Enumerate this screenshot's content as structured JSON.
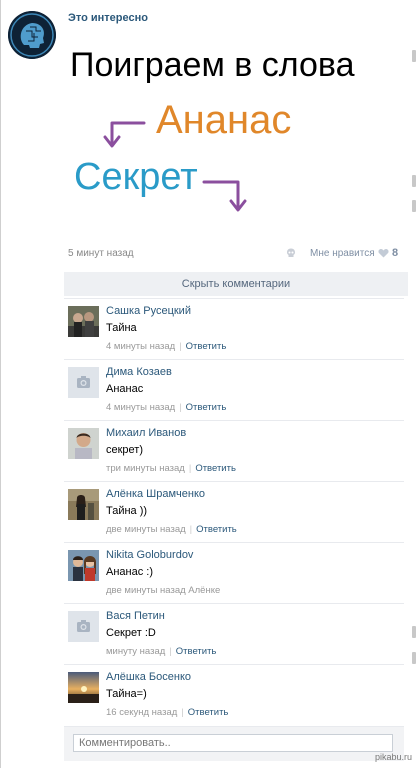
{
  "post": {
    "author": "Это интересно",
    "meme_title": "Поиграем в слова",
    "word_first": "Ананас",
    "word_second": "Секрет",
    "time": "5 минут назад",
    "like_label": "Мне нравится",
    "like_count": "8",
    "hide_comments_label": "Скрыть комментарии"
  },
  "comments": [
    {
      "name": "Сашка Русецкий",
      "text": "Тайна",
      "time": "4 минуты назад",
      "reply": "Ответить"
    },
    {
      "name": "Дима Козаев",
      "text": "Ананас",
      "time": "4 минуты назад",
      "reply": "Ответить"
    },
    {
      "name": "Михаил Иванов",
      "text": "секрет)",
      "time": "три минуты назад",
      "reply": "Ответить"
    },
    {
      "name": "Алёнка Шрамченко",
      "text": "Тайна ))",
      "time": "две минуты назад",
      "reply": "Ответить"
    },
    {
      "name": "Nikita Goloburdov",
      "text": "Ананас :)",
      "time": "две минуты назад Алёнке",
      "reply": ""
    },
    {
      "name": "Вася Петин",
      "text": "Секрет :D",
      "time": "минуту назад",
      "reply": "Ответить"
    },
    {
      "name": "Алёшка Босенко",
      "text": "Тайна=)",
      "time": "16 секунд назад",
      "reply": "Ответить"
    }
  ],
  "comment_input": {
    "placeholder": "Комментировать.."
  },
  "watermark": "pikabu.ru",
  "colors": {
    "link": "#2b587a",
    "word_first": "#e0872a",
    "word_second": "#2a9bc8",
    "arrow": "#8b4f9e"
  }
}
